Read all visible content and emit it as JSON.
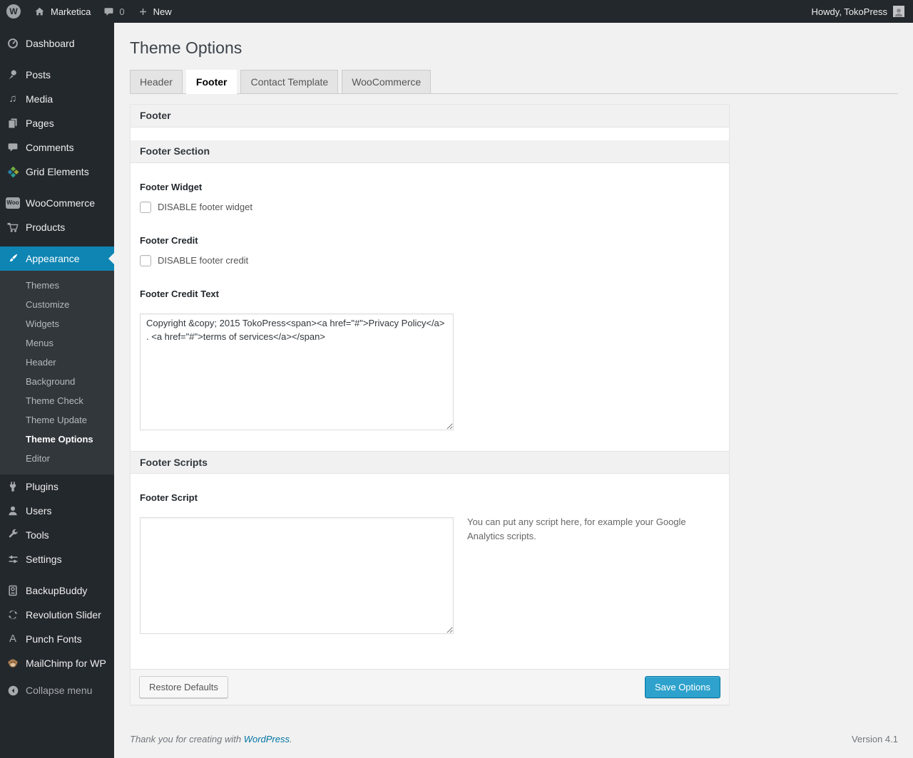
{
  "admin_bar": {
    "wordpress_logo_letter": "W",
    "site_name": "Marketica",
    "comments_count": "0",
    "new_label": "New",
    "user_greeting": "Howdy, TokoPress"
  },
  "sidebar": {
    "items": [
      {
        "label": "Dashboard",
        "icon": "dashboard-icon"
      },
      {
        "label": "Posts",
        "icon": "pin-icon"
      },
      {
        "label": "Media",
        "icon": "media-icon",
        "glyph": "♫"
      },
      {
        "label": "Pages",
        "icon": "pages-icon"
      },
      {
        "label": "Comments",
        "icon": "comments-icon"
      },
      {
        "label": "Grid Elements",
        "icon": "grid-elements-icon"
      },
      {
        "label": "WooCommerce",
        "icon": "woocommerce-badge-icon",
        "badge_text": "Woo"
      },
      {
        "label": "Products",
        "icon": "cart-icon"
      },
      {
        "label": "Appearance",
        "icon": "brush-icon"
      },
      {
        "label": "Plugins",
        "icon": "plugin-icon"
      },
      {
        "label": "Users",
        "icon": "user-icon"
      },
      {
        "label": "Tools",
        "icon": "wrench-icon"
      },
      {
        "label": "Settings",
        "icon": "sliders-icon"
      },
      {
        "label": "BackupBuddy",
        "icon": "backup-drive-icon"
      },
      {
        "label": "Revolution Slider",
        "icon": "rotate-arrows-icon"
      },
      {
        "label": "Punch Fonts",
        "icon": "letter-a-icon",
        "glyph": "A"
      },
      {
        "label": "MailChimp for WP",
        "icon": "monkey-icon"
      },
      {
        "label": "Collapse menu",
        "icon": "collapse-arrow-icon"
      }
    ],
    "appearance_submenu": [
      "Themes",
      "Customize",
      "Widgets",
      "Menus",
      "Header",
      "Background",
      "Theme Check",
      "Theme Update",
      "Theme Options",
      "Editor"
    ],
    "active_item": "Appearance",
    "active_submenu_item": "Theme Options"
  },
  "main": {
    "page_title": "Theme Options",
    "tabs": [
      "Header",
      "Footer",
      "Contact Template",
      "WooCommerce"
    ],
    "active_tab": "Footer"
  },
  "panel": {
    "box_title": "Footer",
    "section_footer": {
      "title": "Footer Section",
      "footer_widget": {
        "label": "Footer Widget",
        "checkbox_label": "DISABLE footer widget",
        "checked": false
      },
      "footer_credit": {
        "label": "Footer Credit",
        "checkbox_label": "DISABLE footer credit",
        "checked": false
      },
      "footer_credit_text": {
        "label": "Footer Credit Text",
        "value": "Copyright &copy; 2015 TokoPress<span><a href=\"#\">Privacy Policy</a> . <a href=\"#\">terms of services</a></span>"
      }
    },
    "section_scripts": {
      "title": "Footer Scripts",
      "footer_script": {
        "label": "Footer Script",
        "value": "",
        "help": "You can put any script here, for example your Google Analytics scripts."
      }
    },
    "restore_button": "Restore Defaults",
    "save_button": "Save Options"
  },
  "footer": {
    "thank_you_text": "Thank you for creating with ",
    "wordpress_link_label": "WordPress",
    "period": ".",
    "version": "Version 4.1"
  },
  "colors": {
    "accent_blue": "#0e85b3",
    "button_blue": "#2ea2cc",
    "link_blue": "#0074a2",
    "admin_dark": "#23282d",
    "submenu_dark": "#32373c"
  }
}
